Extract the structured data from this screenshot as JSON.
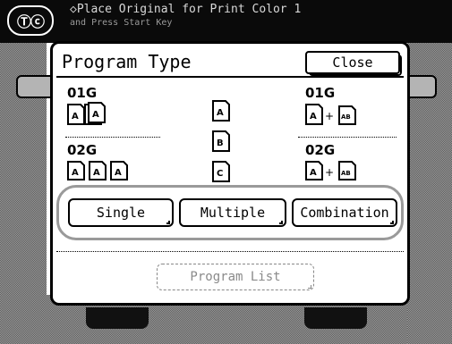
{
  "header": {
    "logo_text": "Ⓣⓒ",
    "message_line1": "◇Place Original for Print Color 1",
    "message_line2": "and Press Start Key"
  },
  "dialog": {
    "title": "Program Type",
    "close_label": "Close",
    "left_group": {
      "top_label": "01G",
      "bottom_label": "02G"
    },
    "right_group": {
      "top_label": "01G",
      "bottom_label": "02G"
    },
    "center_icon_letters": [
      "A",
      "B",
      "C"
    ],
    "ab_badge": "AB",
    "plus": "+",
    "options": [
      {
        "label": "Single"
      },
      {
        "label": "Multiple"
      },
      {
        "label": "Combination"
      }
    ],
    "program_list_label": "Program List",
    "program_list_enabled": false
  },
  "colors": {
    "frame_dark": "#0a0a0a",
    "dither_light": "#9a9a9a",
    "dither_dark": "#5e5e5e",
    "disabled_text": "#8a8a8a"
  }
}
